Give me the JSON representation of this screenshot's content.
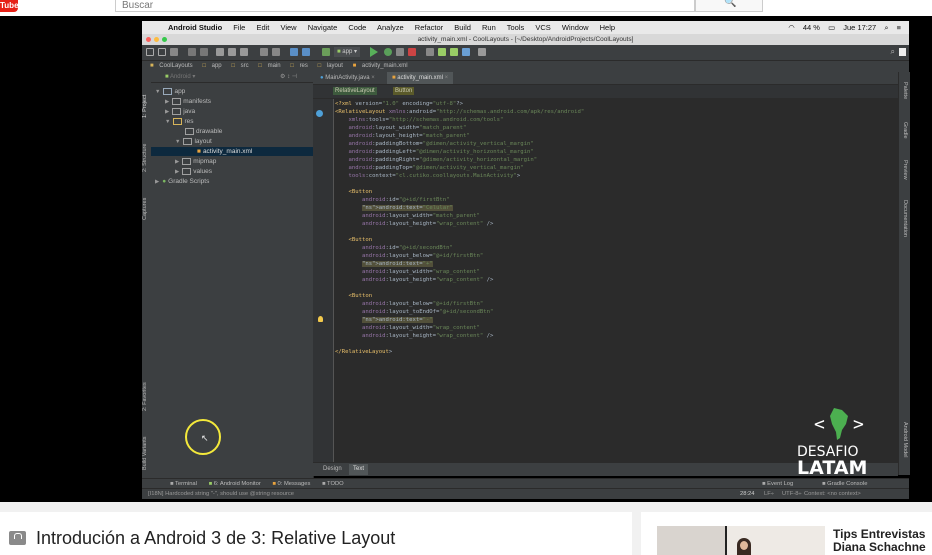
{
  "browser": {
    "logo_text": "Tube",
    "search_placeholder": "Buscar",
    "search_icon": "search-icon"
  },
  "menubar": {
    "app_name": "Android Studio",
    "items": [
      "File",
      "Edit",
      "View",
      "Navigate",
      "Code",
      "Analyze",
      "Refactor",
      "Build",
      "Run",
      "Tools",
      "VCS",
      "Window",
      "Help"
    ],
    "battery": "44 %",
    "clock": "Jue 17:27"
  },
  "window": {
    "title": "activity_main.xml - CoolLayouts - [~/Desktop/AndroidProjects/CoolLayouts]",
    "toolbar_run_config": "app"
  },
  "navbar": {
    "crumbs": [
      "CoolLayouts",
      "app",
      "src",
      "main",
      "res",
      "layout",
      "activity_main.xml"
    ]
  },
  "sidebar_left": {
    "labels": [
      "1: Project",
      "2: Structure",
      "Captures",
      "2: Favorites",
      "Build Variants"
    ]
  },
  "project": {
    "view_selector": "Android",
    "tree": [
      {
        "label": "app",
        "indent": 0,
        "arrow": "▼"
      },
      {
        "label": "manifests",
        "indent": 1,
        "arrow": "▶"
      },
      {
        "label": "java",
        "indent": 1,
        "arrow": "▶"
      },
      {
        "label": "res",
        "indent": 1,
        "arrow": "▼"
      },
      {
        "label": "drawable",
        "indent": 2,
        "arrow": ""
      },
      {
        "label": "layout",
        "indent": 2,
        "arrow": "▼"
      },
      {
        "label": "activity_main.xml",
        "indent": 3,
        "arrow": ""
      },
      {
        "label": "mipmap",
        "indent": 2,
        "arrow": "▶"
      },
      {
        "label": "values",
        "indent": 2,
        "arrow": "▶"
      },
      {
        "label": "Gradle Scripts",
        "indent": 0,
        "arrow": "▶"
      }
    ]
  },
  "editor": {
    "tabs": [
      "MainActivity.java",
      "activity_main.xml"
    ],
    "breadcrumb": [
      "RelativeLayout",
      "Button"
    ],
    "lines": [
      "<?xml version=\"1.0\" encoding=\"utf-8\"?>",
      "<RelativeLayout xmlns:android=\"http://schemas.android.com/apk/res/android\"",
      "    xmlns:tools=\"http://schemas.android.com/tools\"",
      "    android:layout_width=\"match_parent\"",
      "    android:layout_height=\"match_parent\"",
      "    android:paddingBottom=\"@dimen/activity_vertical_margin\"",
      "    android:paddingLeft=\"@dimen/activity_horizontal_margin\"",
      "    android:paddingRight=\"@dimen/activity_horizontal_margin\"",
      "    android:paddingTop=\"@dimen/activity_vertical_margin\"",
      "    tools:context=\"cl.cutiko.coollayouts.MainActivity\">",
      "",
      "    <Button",
      "        android:id=\"@+id/firstBtn\"",
      "        android:text=\"Celular\"",
      "        android:layout_width=\"match_parent\"",
      "        android:layout_height=\"wrap_content\" />",
      "",
      "    <Button",
      "        android:id=\"@+id/secondBtn\"",
      "        android:layout_below=\"@+id/firstBtn\"",
      "        android:text=\"+\"",
      "        android:layout_width=\"wrap_content\"",
      "        android:layout_height=\"wrap_content\" />",
      "",
      "    <Button",
      "        android:layout_below=\"@+id/firstBtn\"",
      "        android:layout_toEndOf=\"@+id/secondBtn\"",
      "        android:text=\"-\"",
      "        android:layout_width=\"wrap_content\"",
      "        android:layout_height=\"wrap_content\" />",
      "",
      "</RelativeLayout>"
    ],
    "design_tabs": [
      "Design",
      "Text"
    ],
    "active_design_tab": "Text"
  },
  "sidebar_right": {
    "labels": [
      "Palette",
      "Gradle",
      "Preview",
      "Documentation",
      "Android Model"
    ]
  },
  "bottom_tools": {
    "left": [
      "Terminal",
      "6: Android Monitor",
      "0: Messages",
      "TODO"
    ],
    "right": [
      "Event Log",
      "Gradle Console"
    ]
  },
  "status": {
    "message": "[I18N] Hardcoded string \"-\", should use @string resource",
    "position": "28:24",
    "line_sep": "LF÷",
    "encoding": "UTF-8÷",
    "context": "Context: <no context>"
  },
  "watermark": {
    "line1": "DESAFIO",
    "line2": "LATAM"
  },
  "page": {
    "video_title": "Introdución a Android 3 de 3: Relative Layout",
    "recommended_title_line1": "Tips Entrevistas",
    "recommended_title_line2": "Diana Schachne"
  },
  "colors": {
    "ide_bg": "#2b2b2b",
    "ide_panel": "#3c3f41",
    "xml_tag": "#e8bf6a",
    "xml_string": "#6a8759",
    "xml_namespace": "#9876aa",
    "cursor_ring": "#f4e93b",
    "logo_green": "#4caf50"
  }
}
